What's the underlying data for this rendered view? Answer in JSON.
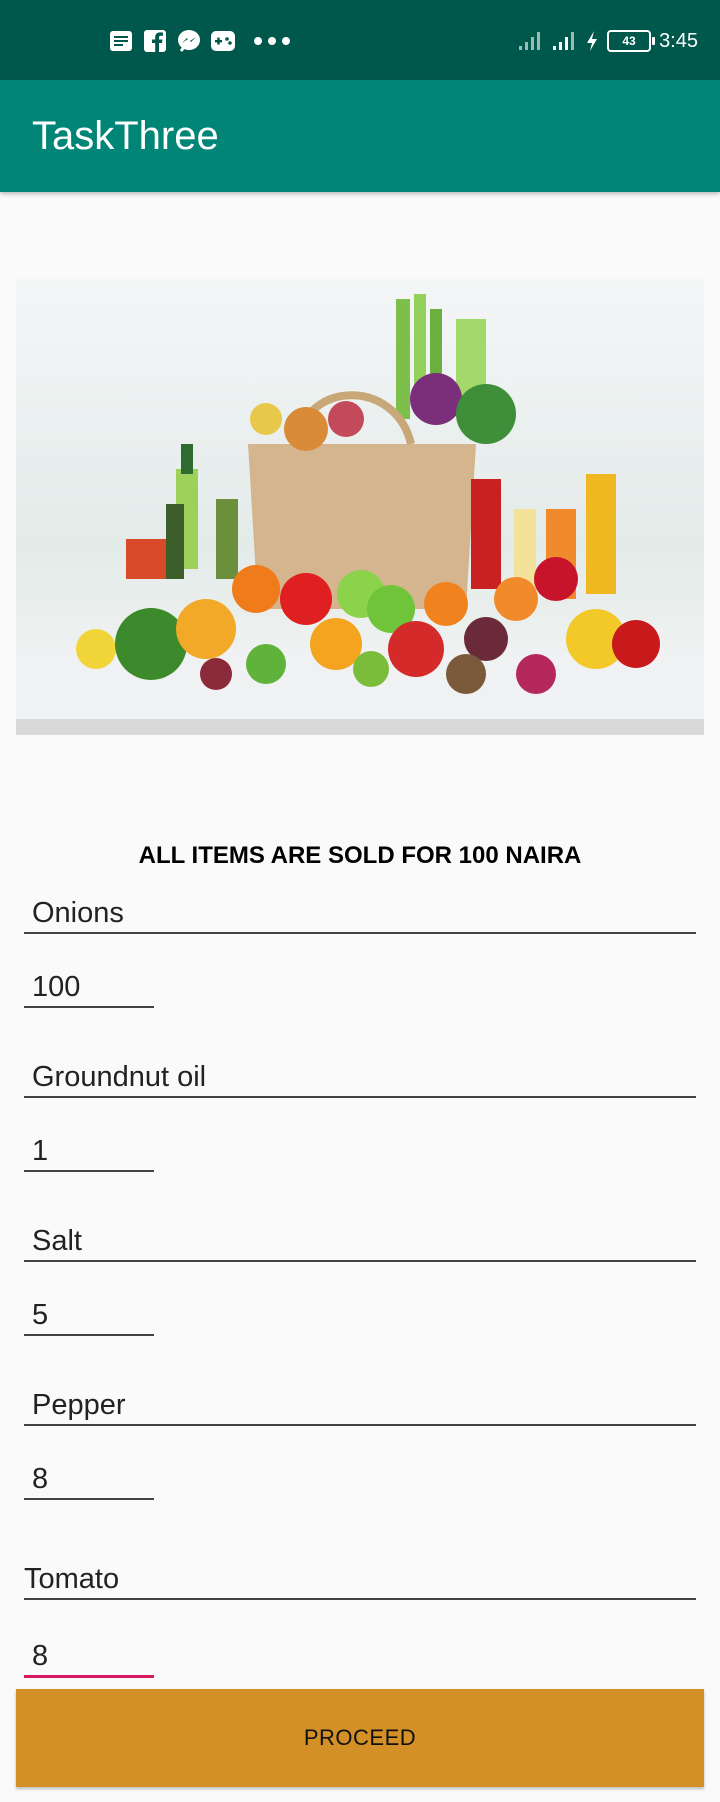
{
  "status_bar": {
    "time": "3:45",
    "battery": "43",
    "left_icons": [
      "news-icon",
      "facebook-icon",
      "messenger-icon",
      "game-icon",
      "more-dots-icon"
    ],
    "right_icons": [
      "signal-icon",
      "signal-icon",
      "charging-icon",
      "battery-icon"
    ]
  },
  "app_bar": {
    "title": "TaskThree"
  },
  "hero_image": {
    "description_icon": "groceries-image"
  },
  "notice": "ALL ITEMS ARE SOLD FOR 100 NAIRA",
  "items": [
    {
      "name": "Onions",
      "qty": "100"
    },
    {
      "name": "Groundnut oil",
      "qty": "1"
    },
    {
      "name": "Salt",
      "qty": "5"
    },
    {
      "name": "Pepper",
      "qty": "8"
    },
    {
      "name": "Tomato",
      "qty": "8"
    }
  ],
  "proceed_label": "PROCEED",
  "colors": {
    "status_bar": "#00574b",
    "app_bar": "#008577",
    "button": "#d39027",
    "accent": "#d81b60"
  }
}
